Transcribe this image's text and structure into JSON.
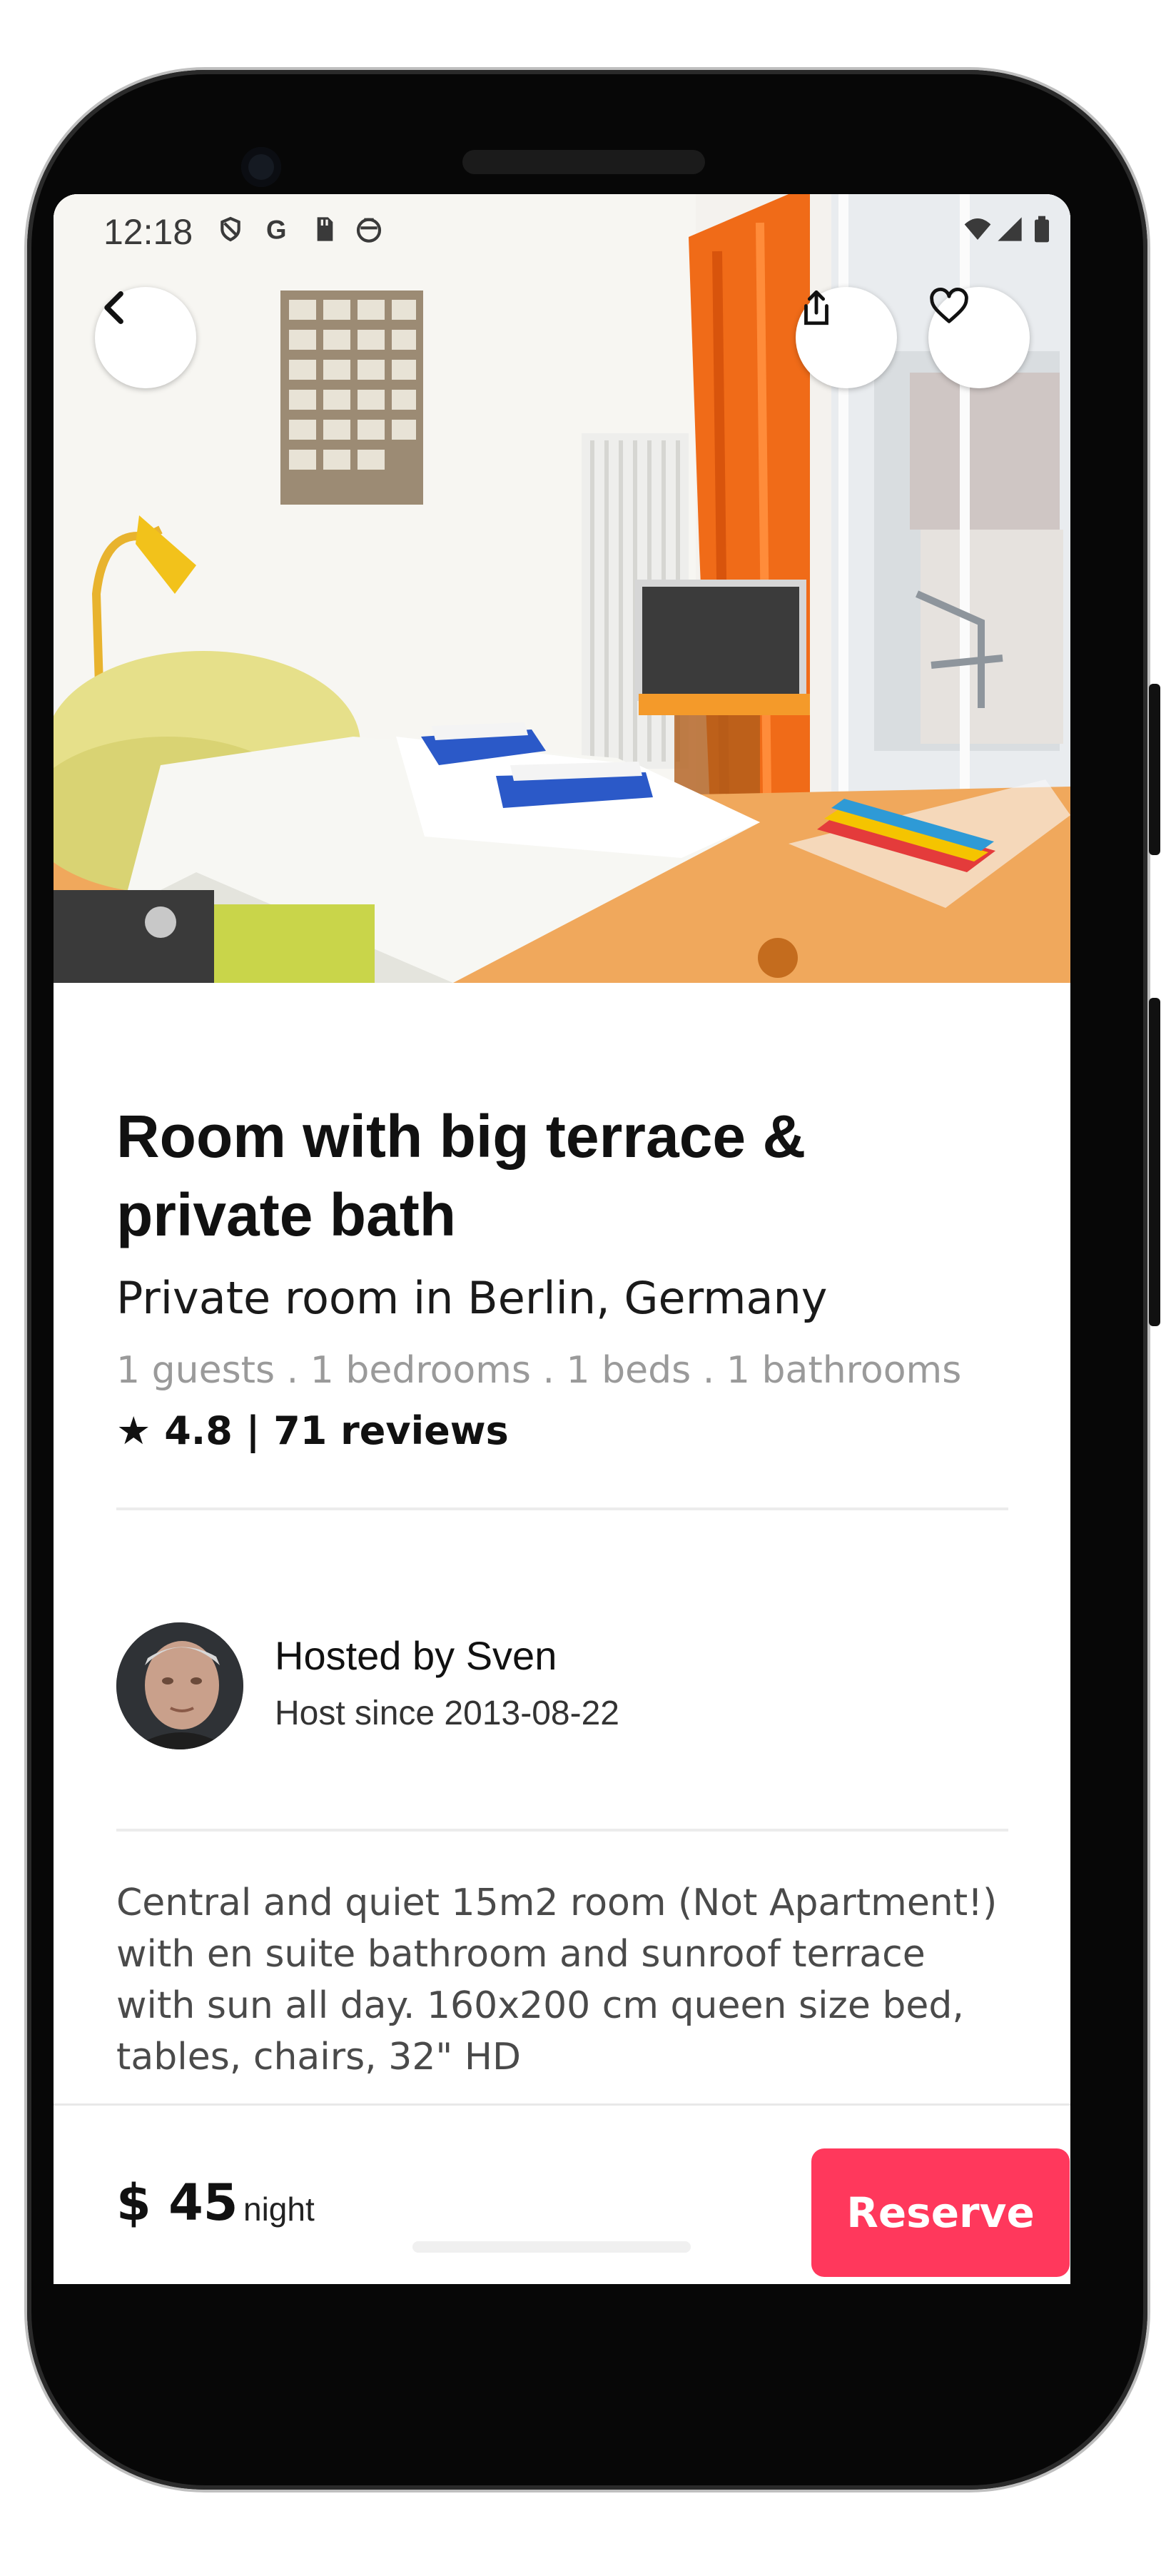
{
  "status_bar": {
    "time": "12:18",
    "left_icons": [
      "do-not-disturb-icon",
      "google-icon",
      "sd-card-icon",
      "shield-icon"
    ],
    "right_icons": [
      "wifi-icon",
      "signal-icon",
      "battery-icon"
    ]
  },
  "actions": {
    "back_icon": "chevron-left-icon",
    "share_icon": "share-icon",
    "favorite_icon": "heart-icon"
  },
  "listing": {
    "title": "Room with big terrace & private bath",
    "subtitle": "Private room in Berlin, Germany",
    "meta": "1 guests . 1 bedrooms . 1 beds . 1 bathrooms",
    "rating": "★ 4.8 | 71 reviews"
  },
  "host": {
    "name": "Hosted by Sven",
    "since": "Host since 2013-08-22"
  },
  "description": "Central and quiet 15m2 room (Not Apartment!) with en suite bathroom and sunroof terrace with sun all day. 160x200 cm queen size bed, tables, chairs,  32\" HD",
  "booking": {
    "price": "$ 45",
    "unit": "night",
    "reserve_label": "Reserve"
  },
  "colors": {
    "accent": "#ff385c",
    "text": "#111111",
    "muted": "#9a9a9a"
  }
}
